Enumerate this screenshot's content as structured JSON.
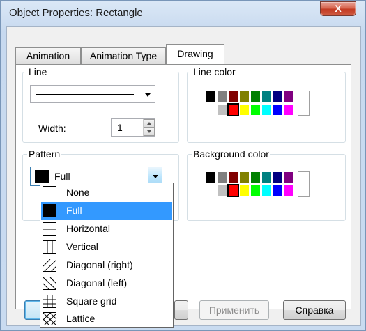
{
  "window": {
    "title": "Object Properties: Rectangle",
    "close_glyph": "X"
  },
  "tabs": [
    {
      "label": "Animation",
      "active": false
    },
    {
      "label": "Animation Type",
      "active": false
    },
    {
      "label": "Drawing",
      "active": true
    }
  ],
  "line_group": {
    "label": "Line",
    "width_label": "Width:",
    "width_value": "1"
  },
  "line_color_group": {
    "label": "Line color"
  },
  "pattern_group": {
    "label": "Pattern",
    "selected": "Full"
  },
  "background_color_group": {
    "label": "Background color"
  },
  "palette_colors": {
    "row1": [
      "#000000",
      "#808080",
      "#800000",
      "#808000",
      "#008000",
      "#008080",
      "#000080",
      "#800080"
    ],
    "row2": [
      "#ffffff",
      "#c0c0c0",
      "#ff0000",
      "#ffff00",
      "#00ff00",
      "#00ffff",
      "#0000ff",
      "#ff00ff"
    ],
    "selected_line_color": "#ff0000",
    "selected_background_color": "#ff0000"
  },
  "pattern_options": [
    {
      "label": "None",
      "icon": "pattern-none-icon"
    },
    {
      "label": "Full",
      "icon": "pattern-full-icon"
    },
    {
      "label": "Horizontal",
      "icon": "pattern-horizontal-icon"
    },
    {
      "label": "Vertical",
      "icon": "pattern-vertical-icon"
    },
    {
      "label": "Diagonal (right)",
      "icon": "pattern-diagonal-right-icon"
    },
    {
      "label": "Diagonal (left)",
      "icon": "pattern-diagonal-left-icon"
    },
    {
      "label": "Square grid",
      "icon": "pattern-square-grid-icon"
    },
    {
      "label": "Lattice",
      "icon": "pattern-lattice-icon"
    }
  ],
  "buttons": {
    "apply": "Применить",
    "help": "Справка"
  }
}
